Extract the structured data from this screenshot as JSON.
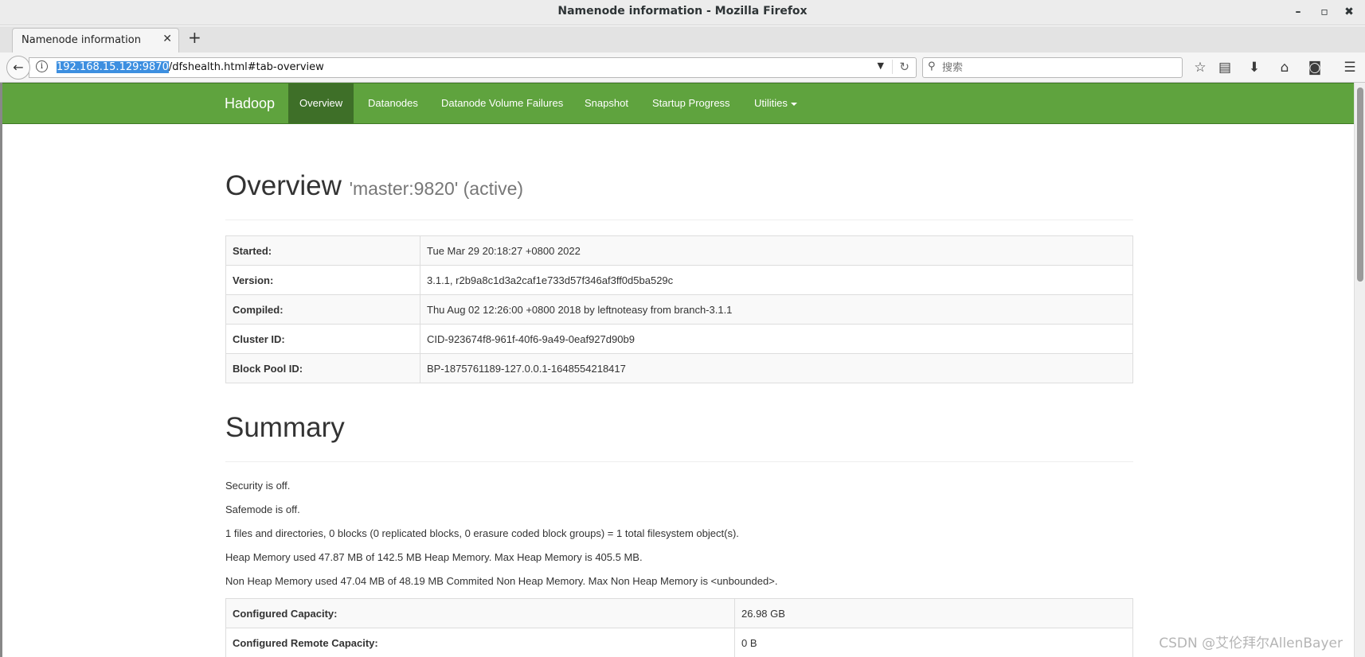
{
  "window": {
    "title": "Namenode information - Mozilla Firefox",
    "minimize": "–",
    "maximize": "▫",
    "close": "✖"
  },
  "tabs": [
    {
      "label": "Namenode information",
      "close": "✕"
    }
  ],
  "new_tab": "+",
  "nav": {
    "back": "←",
    "info": "i",
    "url_selected": "192.168.15.129:9870",
    "url_rest": "/dfshealth.html#tab-overview",
    "dropdown": "▼",
    "reload": "↻",
    "search_icon": "⚲",
    "search_placeholder": "搜索"
  },
  "toolbar_icons": {
    "bookmark": "☆",
    "reading_list": "▤",
    "download": "⬇",
    "home": "⌂",
    "pocket": "◙",
    "menu": "☰"
  },
  "hadoop": {
    "brand": "Hadoop",
    "menu": [
      {
        "label": "Overview",
        "active": true
      },
      {
        "label": "Datanodes"
      },
      {
        "label": "Datanode Volume Failures"
      },
      {
        "label": "Snapshot"
      },
      {
        "label": "Startup Progress"
      },
      {
        "label": "Utilities"
      }
    ]
  },
  "overview": {
    "title": "Overview",
    "subtitle": "'master:9820' (active)",
    "rows": [
      {
        "key": "Started:",
        "value": "Tue Mar 29 20:18:27 +0800 2022"
      },
      {
        "key": "Version:",
        "value": "3.1.1, r2b9a8c1d3a2caf1e733d57f346af3ff0d5ba529c"
      },
      {
        "key": "Compiled:",
        "value": "Thu Aug 02 12:26:00 +0800 2018 by leftnoteasy from branch-3.1.1"
      },
      {
        "key": "Cluster ID:",
        "value": "CID-923674f8-961f-40f6-9a49-0eaf927d90b9"
      },
      {
        "key": "Block Pool ID:",
        "value": "BP-1875761189-127.0.0.1-1648554218417"
      }
    ]
  },
  "summary": {
    "title": "Summary",
    "lines": [
      "Security is off.",
      "Safemode is off.",
      "1 files and directories, 0 blocks (0 replicated blocks, 0 erasure coded block groups) = 1 total filesystem object(s).",
      "Heap Memory used 47.87 MB of 142.5 MB Heap Memory. Max Heap Memory is 405.5 MB.",
      "Non Heap Memory used 47.04 MB of 48.19 MB Commited Non Heap Memory. Max Non Heap Memory is <unbounded>."
    ],
    "rows": [
      {
        "key": "Configured Capacity:",
        "value": "26.98 GB"
      },
      {
        "key": "Configured Remote Capacity:",
        "value": "0 B"
      }
    ]
  },
  "watermark": "CSDN @艾伦拜尔AllenBayer"
}
